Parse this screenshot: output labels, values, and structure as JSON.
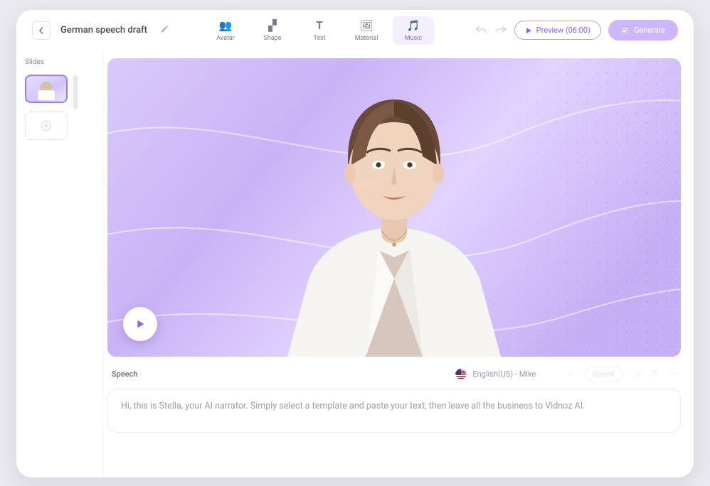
{
  "project": {
    "title": "German speech draft"
  },
  "toolbar": {
    "items": [
      {
        "id": "avatar",
        "label": "Avatar",
        "glyph": "👥",
        "active": false
      },
      {
        "id": "shape",
        "label": "Shape",
        "glyph": "▞",
        "active": false
      },
      {
        "id": "text",
        "label": "Text",
        "glyph": "𝐓",
        "active": false
      },
      {
        "id": "material",
        "label": "Material",
        "glyph": "🖼",
        "active": false
      },
      {
        "id": "music",
        "label": "Music",
        "glyph": "🎵",
        "active": true
      }
    ],
    "preview_label": "Preview (06:00)",
    "generate_label": "Generate"
  },
  "sidebar": {
    "slides_label": "Slides"
  },
  "speech": {
    "section_label": "Speech",
    "voice_label": "English(US) - Mike",
    "speed_label": "Speed",
    "text": "Hi, this is Stella, your AI narrator. Simply select a template and paste your text, then leave all the business to Vidnoz AI."
  },
  "colors": {
    "accent": "#8a66f0"
  }
}
